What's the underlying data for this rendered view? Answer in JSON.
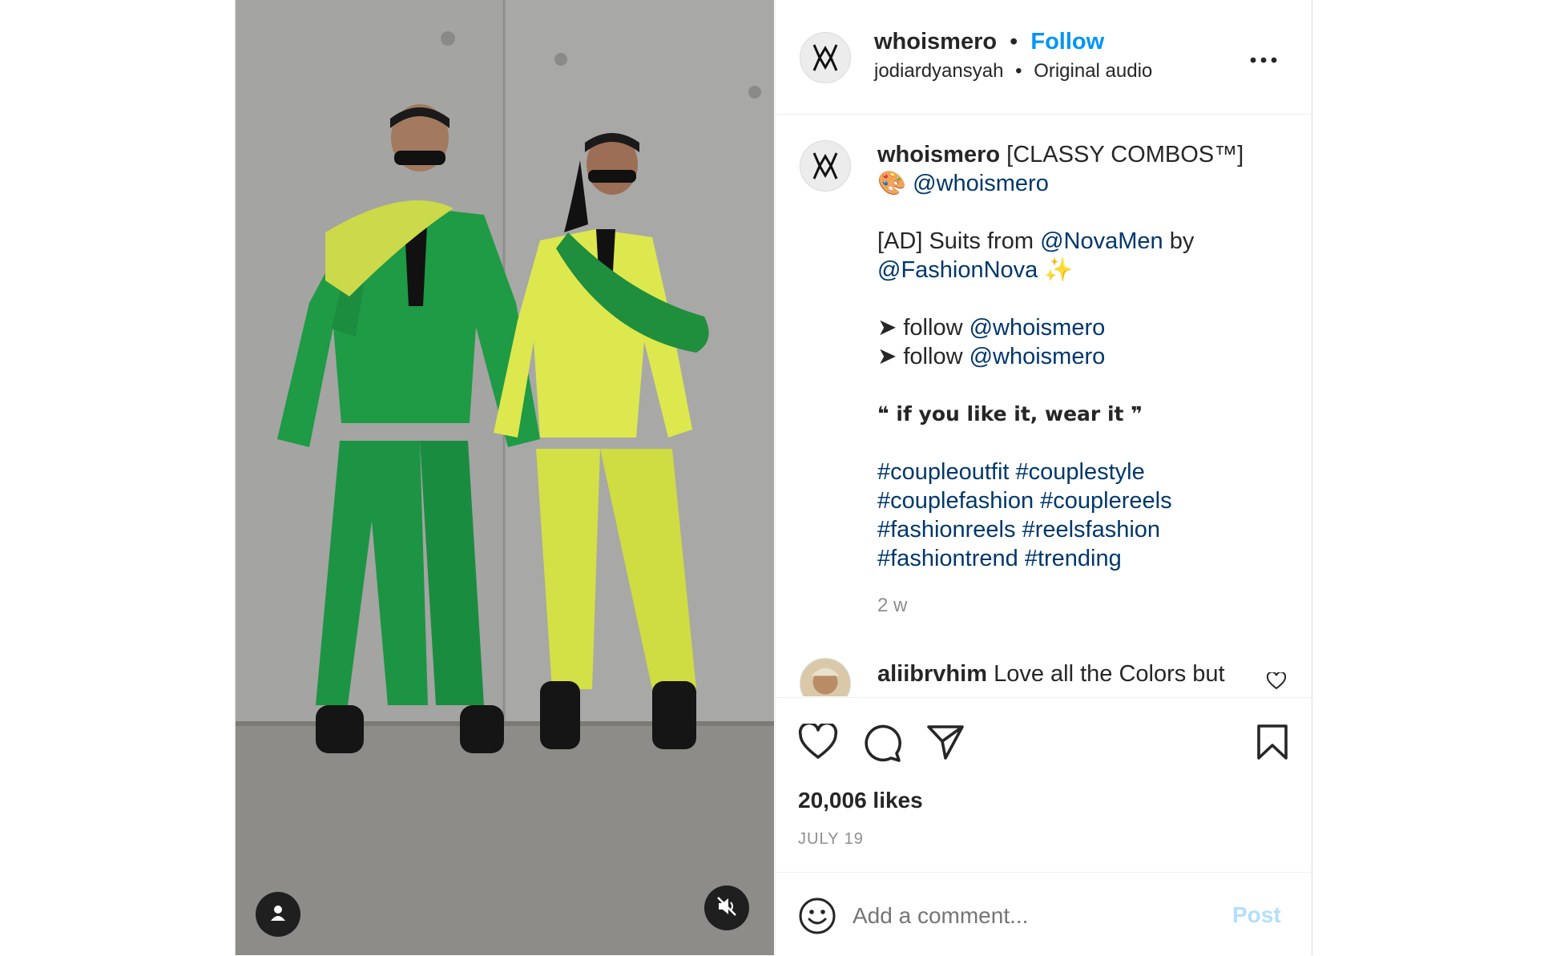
{
  "post": {
    "username": "whoismero",
    "dot": "•",
    "follow_label": "Follow",
    "audio_author": "jodiardyansyah",
    "audio_dot": "•",
    "audio_label": "Original audio",
    "more_icon": "more-horizontal-icon"
  },
  "caption": {
    "username": "whoismero",
    "title": "[CLASSY COMBOS™]",
    "palette_emoji": "🎨",
    "mention_1": "@whoismero",
    "ad_text": "[AD] Suits from",
    "mention_novamen": "@NovaMen",
    "by_text": "by",
    "mention_fashionnova": "@FashionNova",
    "sparkles_emoji": "✨",
    "arrow": "➤",
    "follow_word": "follow",
    "follow_line_1_mention": "@whoismero",
    "follow_line_2_mention": "@whoismero",
    "quote_open": "❝",
    "quote_text": "if you like it, wear it",
    "quote_close": "❞",
    "hashtags": [
      [
        "#coupleoutfit",
        "#couplestyle"
      ],
      [
        "#couplefashion",
        "#couplereels"
      ],
      [
        "#fashionreels",
        "#reelsfashion"
      ],
      [
        "#fashiontrend",
        "#trending"
      ]
    ],
    "age": "2 w"
  },
  "comment": {
    "username": "aliibrvhim",
    "text": "Love all the Colors but"
  },
  "actions": {
    "like_icon": "heart-icon",
    "comment_icon": "comment-icon",
    "share_icon": "send-icon",
    "save_icon": "bookmark-icon",
    "likes": "20,006 likes",
    "date": "JULY 19"
  },
  "add_comment": {
    "emoji_icon": "smile-icon",
    "placeholder": "Add a comment...",
    "post_label": "Post"
  },
  "media": {
    "tag_icon": "user-tag-icon",
    "mute_icon": "sound-off-icon"
  },
  "colors": {
    "link": "#00376b",
    "follow": "#0095f6",
    "post_disabled": "#b2dffc",
    "green_suit": "#1f9a45",
    "yellow_suit": "#dce84e"
  }
}
